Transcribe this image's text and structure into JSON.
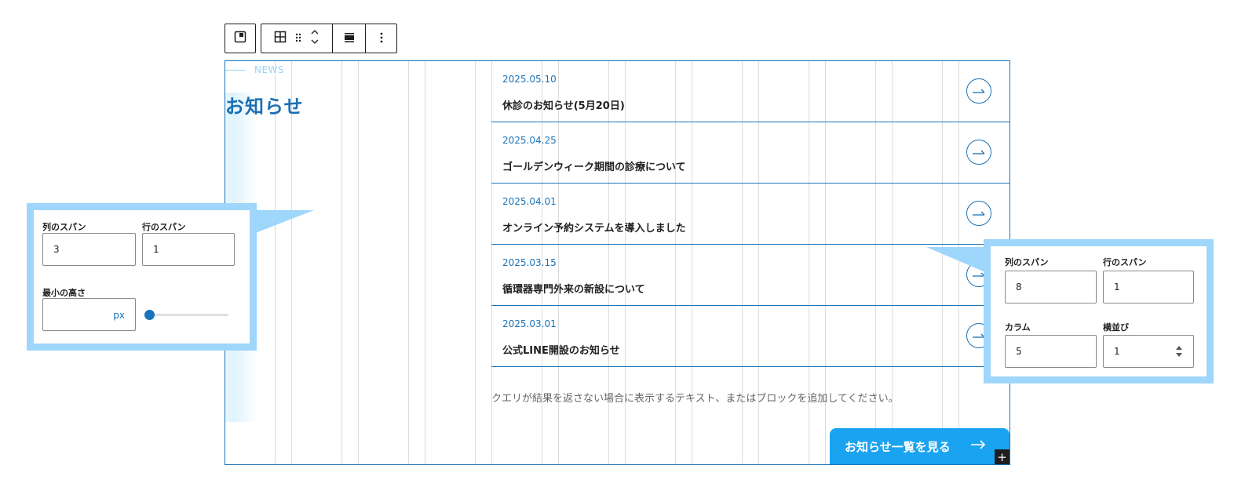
{
  "toolbar": {
    "icons": [
      "block-icon",
      "grid-icon",
      "drag-handle-icon",
      "move-up-down-icon",
      "align-icon",
      "more-options-icon"
    ]
  },
  "section": {
    "eyebrow": "NEWS",
    "heading": "お知らせ"
  },
  "news": [
    {
      "date": "2025.05.10",
      "title": "休診のお知らせ(5月20日)"
    },
    {
      "date": "2025.04.25",
      "title": "ゴールデンウィーク期間の診療について"
    },
    {
      "date": "2025.04.01",
      "title": "オンライン予約システムを導入しました"
    },
    {
      "date": "2025.03.15",
      "title": "循環器専門外来の新設について"
    },
    {
      "date": "2025.03.01",
      "title": "公式LINE開設のお知らせ"
    }
  ],
  "empty_text": "クエリが結果を返さない場合に表示するテキスト、またはブロックを追加してください。",
  "more_button": "お知らせ一覧を見る",
  "left_panel": {
    "col_span_label": "列のスパン",
    "col_span_value": "3",
    "row_span_label": "行のスパン",
    "row_span_value": "1",
    "min_height_label": "最小の高さ",
    "min_height_unit": "px",
    "min_height_slider": 0
  },
  "right_panel": {
    "col_span_label": "列のスパン",
    "col_span_value": "8",
    "row_span_label": "行のスパン",
    "row_span_value": "1",
    "columns_label": "カラム",
    "columns_value": "5",
    "row_label": "横並び",
    "row_value": "1"
  },
  "colors": {
    "accent": "#1a73b8",
    "button": "#1aa3f0",
    "callout": "#9fd6fb"
  }
}
